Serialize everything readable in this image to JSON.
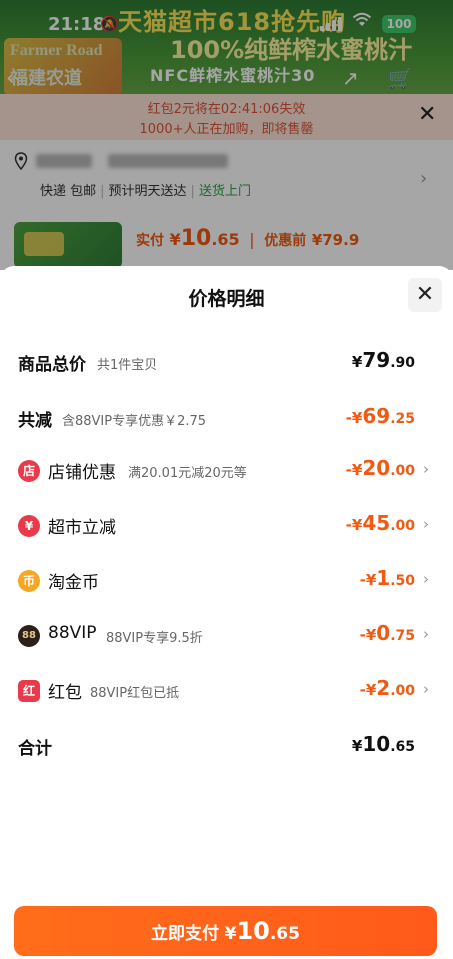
{
  "status_bar": {
    "time": "21:18",
    "battery": "100"
  },
  "banner": {
    "title": "天猫超市618抢先购",
    "headline": "100%纯鲜榨水蜜桃汁",
    "subline": "NFC鲜榨水蜜桃汁30",
    "left_art_top": "Farmer Road",
    "left_art_bottom": "福建农道"
  },
  "timer": {
    "line1": "红包2元将在02:41:06失效",
    "line2": "1000+人正在加购，即将售罄"
  },
  "address": {
    "tags": [
      "快递 包邮",
      "预计明天送达",
      "送货上门"
    ]
  },
  "product": {
    "pay_label": "实付",
    "currency": "¥",
    "pay_int": "10",
    "pay_dec": ".65",
    "orig_label": "优惠前",
    "orig_price": "¥79.9"
  },
  "sheet": {
    "title": "价格明细",
    "rows": [
      {
        "label": "商品总价",
        "sub": "共1件宝贝",
        "currency": "¥",
        "int": "79",
        "dec": ".90"
      },
      {
        "label": "共减",
        "sub": "含88VIP专享优惠￥2.75",
        "currency": "-¥",
        "int": "69",
        "dec": ".25"
      },
      {
        "label": "店铺优惠",
        "sub": "满20.01元减20元等",
        "currency": "-¥",
        "int": "20",
        "dec": ".00"
      },
      {
        "label": "超市立减",
        "sub": "",
        "currency": "-¥",
        "int": "45",
        "dec": ".00"
      },
      {
        "label": "淘金币",
        "sub": "",
        "currency": "-¥",
        "int": "1",
        "dec": ".50"
      },
      {
        "label": "88VIP",
        "sub": "88VIP专享9.5折",
        "currency": "-¥",
        "int": "0",
        "dec": ".75"
      },
      {
        "label": "红包",
        "sub": "88VIP红包已抵",
        "currency": "-¥",
        "int": "2",
        "dec": ".00"
      },
      {
        "label": "合计",
        "sub": "",
        "currency": "¥",
        "int": "10",
        "dec": ".65"
      }
    ],
    "icons": {
      "shop": "店",
      "supermarket": "¥",
      "coin": "币",
      "vip": "88",
      "redpacket": "红"
    }
  },
  "pay_button": {
    "label": "立即支付",
    "currency": "¥",
    "int": "10",
    "dec": ".65"
  },
  "colors": {
    "accent": "#f05a12",
    "button": "#ff6d1a",
    "green": "#2aa146"
  }
}
